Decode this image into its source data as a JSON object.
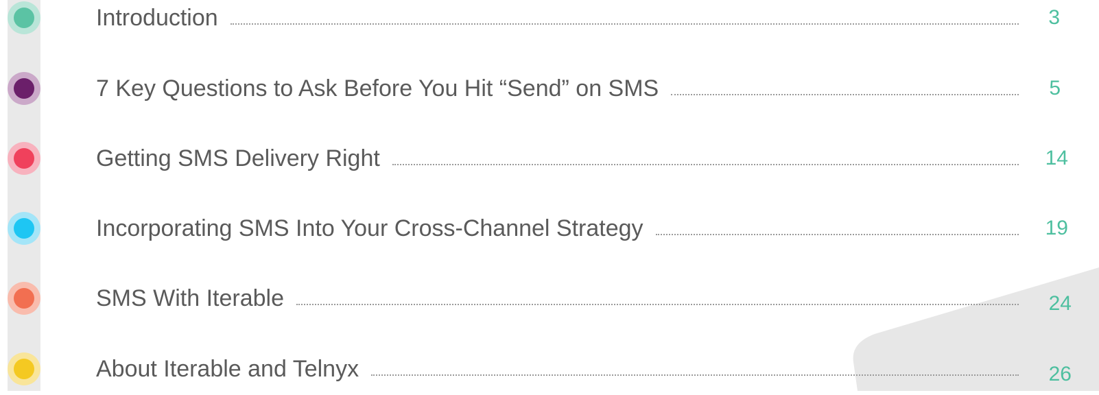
{
  "toc": {
    "entries": [
      {
        "title": "Introduction",
        "page": "3",
        "dot_color": "#5bc3a4",
        "ring_color": "#b9e5d8"
      },
      {
        "title": "7 Key Questions to Ask Before You Hit “Send” on SMS",
        "page": "5",
        "dot_color": "#6b1f6a",
        "ring_color": "#cba9c9"
      },
      {
        "title": "Getting SMS Delivery Right",
        "page": "14",
        "dot_color": "#f0415c",
        "ring_color": "#f8b2be"
      },
      {
        "title": "Incorporating SMS Into Your Cross-Channel Strategy",
        "page": "19",
        "dot_color": "#1ec6f3",
        "ring_color": "#a4e5f8"
      },
      {
        "title": "SMS With Iterable",
        "page": "24",
        "dot_color": "#f26f51",
        "ring_color": "#f9bcad"
      },
      {
        "title": "About Iterable and Telnyx",
        "page": "26",
        "dot_color": "#f4c922",
        "ring_color": "#f9e59a"
      }
    ]
  },
  "colors": {
    "title_text": "#5a5a5a",
    "page_number": "#4dbf9f",
    "rail": "#e9e9e9",
    "leader_dots": "#9a9a9a"
  }
}
